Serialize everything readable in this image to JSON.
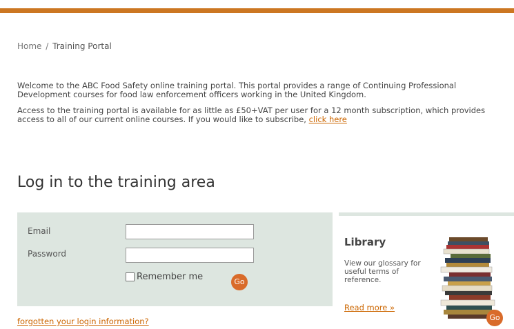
{
  "breadcrumb": {
    "home": "Home",
    "separator": "/",
    "current": "Training Portal"
  },
  "intro": {
    "p1": "Welcome to the ABC Food Safety online training portal. This portal provides a range of Continuing Professional Development courses for food law enforcement officers working in the United Kingdom.",
    "p2_text": "Access to the training portal is available for as little as £50+VAT per user for a 12 month subscription, which provides access to all of our current online courses. If you would like to subscribe,",
    "p2_link": "click here"
  },
  "login": {
    "heading": "Log in to the training area",
    "email_label": "Email",
    "password_label": "Password",
    "remember_label": "Remember me",
    "go_label": "Go",
    "forgot_link": "forgotten your login information?"
  },
  "library": {
    "title": "Library",
    "description": "View our glossary for useful terms of reference.",
    "read_more": "Read more »",
    "go_label": "Go"
  },
  "colors": {
    "accent": "#cc7722",
    "panel": "#dde6e0",
    "button": "#d96b2a"
  }
}
